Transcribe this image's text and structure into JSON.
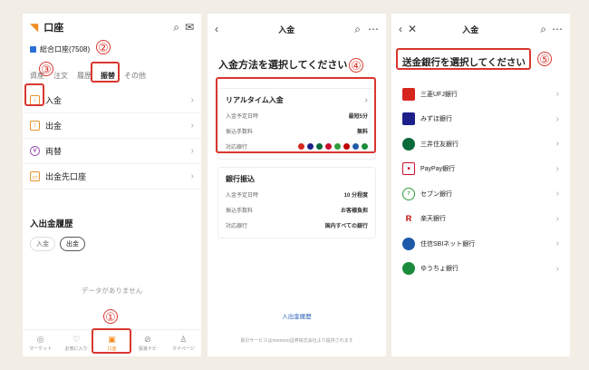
{
  "phone1": {
    "title": "口座",
    "account": "総合口座(7508)",
    "tabs": [
      "資産",
      "注文",
      "履歴",
      "振替",
      "その他"
    ],
    "menu": [
      {
        "label": "入金",
        "icon": "deposit-icon"
      },
      {
        "label": "出金",
        "icon": "withdraw-icon"
      },
      {
        "label": "両替",
        "icon": "exchange-icon"
      },
      {
        "label": "出金先口座",
        "icon": "bank-account-icon"
      }
    ],
    "history_title": "入出金履歴",
    "chips": [
      "入金",
      "出金"
    ],
    "empty_text": "データがありません",
    "nav": [
      "マーケット",
      "お気に入り",
      "口座",
      "投資ナビ",
      "マイページ"
    ]
  },
  "phone2": {
    "title": "入金",
    "heading": "入金方法を選択してください",
    "card1": {
      "title": "リアルタイム入金",
      "rows": [
        {
          "k": "入金予定日時",
          "v": "最短5分"
        },
        {
          "k": "振込手数料",
          "v": "無料"
        },
        {
          "k": "対応銀行",
          "v": ""
        }
      ]
    },
    "card2": {
      "title": "銀行振込",
      "rows": [
        {
          "k": "入金予定日時",
          "v": "10 分程度"
        },
        {
          "k": "振込手数料",
          "v": "お客様負担"
        },
        {
          "k": "対応銀行",
          "v": "国内すべての銀行"
        }
      ]
    },
    "link": "入出金履歴",
    "footer": "取引サービスはmoomoo証券株式会社より提供されます"
  },
  "phone3": {
    "title": "入金",
    "heading": "送金銀行を選択してください",
    "banks": [
      {
        "label": "三菱UFJ銀行",
        "color": "#d7261e"
      },
      {
        "label": "みずほ銀行",
        "color": "#1d2088"
      },
      {
        "label": "三井住友銀行",
        "color": "#0a6b3a"
      },
      {
        "label": "PayPay銀行",
        "color": "#c8102e"
      },
      {
        "label": "セブン銀行",
        "color": "#2e9e3e"
      },
      {
        "label": "楽天銀行",
        "color": "#bf0000"
      },
      {
        "label": "住信SBIネット銀行",
        "color": "#1e5aa8"
      },
      {
        "label": "ゆうちょ銀行",
        "color": "#1a8b3c"
      }
    ]
  },
  "annotations": [
    "①",
    "②",
    "③",
    "④",
    "⑤"
  ]
}
